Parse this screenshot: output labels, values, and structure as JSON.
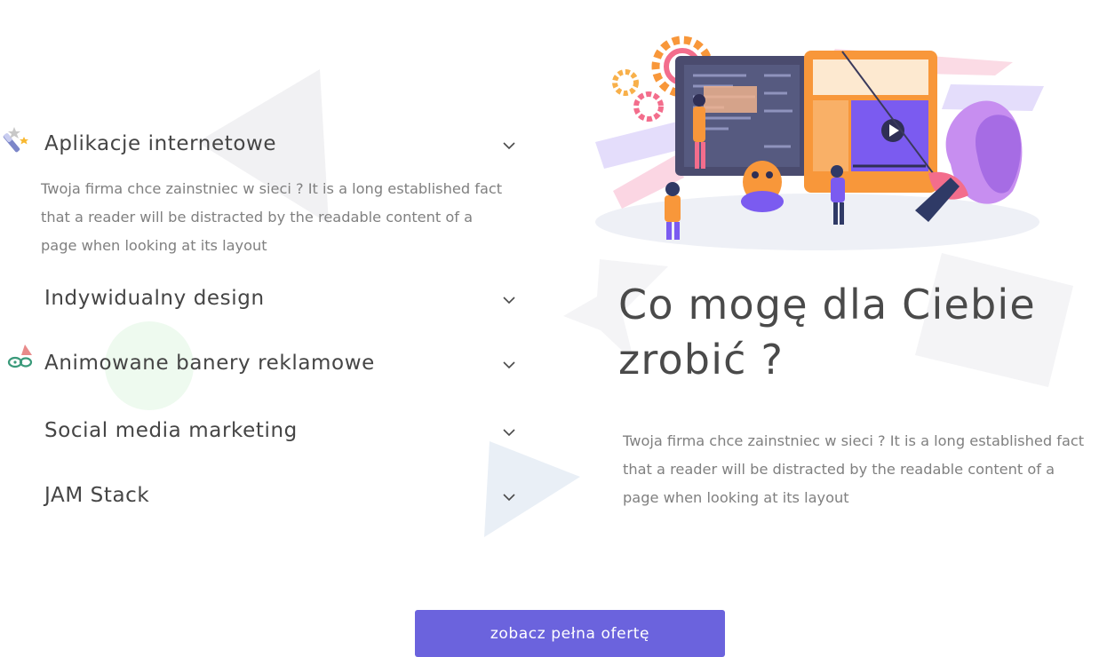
{
  "accordion": {
    "items": [
      {
        "title": "Aplikacje internetowe",
        "expanded": true,
        "icon": "magic-wand-icon",
        "body": "Twoja firma chce zainstniec w sieci ? It is a long established fact that a reader will be distracted by the readable content of a page when looking at its layout"
      },
      {
        "title": "Indywidualny design",
        "expanded": false
      },
      {
        "title": "Animowane banery reklamowe",
        "expanded": false,
        "icon": "party-mask-icon"
      },
      {
        "title": "Social media marketing",
        "expanded": false
      },
      {
        "title": "JAM Stack",
        "expanded": false
      }
    ]
  },
  "section": {
    "title": "Co mogę dla Ciebie zrobić ?",
    "text": "Twoja firma chce zainstniec w sieci ? It is a long established fact that a reader will be distracted by the readable content of a page when looking at its layout"
  },
  "cta": {
    "label": "zobacz pełna ofertę"
  },
  "colors": {
    "accent": "#6b63dd",
    "heading": "#454545",
    "body_text": "#808080",
    "orange": "#f8973a",
    "purple": "#7b5bf0"
  }
}
